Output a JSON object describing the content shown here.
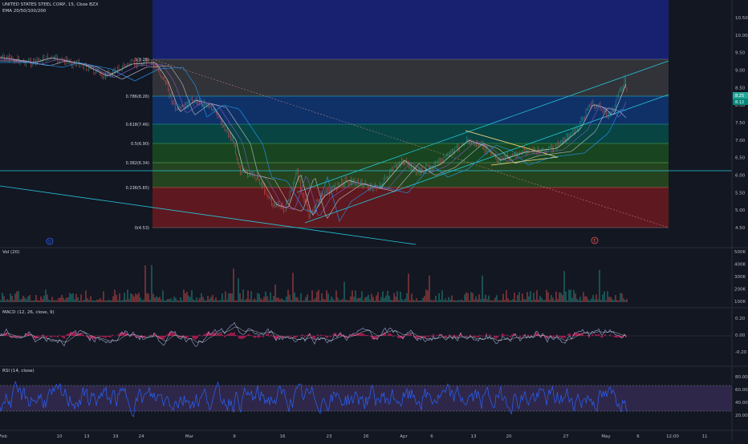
{
  "header": {
    "symbol_line": "UNITED STATES STEEL CORP, 15, Cboe BZX",
    "indicator_ema": "EMA 20/50/100/200"
  },
  "panes": {
    "volume_title": "Vol (20)",
    "macd_title": "MACD (12, 26, close, 9)",
    "rsi_title": "RSI (14, close)"
  },
  "price_axis": [
    "10.50",
    "10.00",
    "9.50",
    "9.00",
    "8.50",
    "8.00",
    "7.50",
    "7.00",
    "6.50",
    "6.00",
    "5.50",
    "5.00",
    "4.50"
  ],
  "price_tags": {
    "current": "8.25",
    "second": "8.12"
  },
  "fib_levels": [
    {
      "label": "0.786(8.26)"
    },
    {
      "label": "0.618(7.46)"
    },
    {
      "label": "0.5(6.90)"
    },
    {
      "label": "0.382(6.34)"
    },
    {
      "label": "0.236(5.65)"
    },
    {
      "label": "0(4.53)"
    },
    {
      "label": "1(9.28)"
    }
  ],
  "volume_axis": [
    "500K",
    "400K",
    "300K",
    "200K",
    "100K"
  ],
  "macd_axis": [
    "0.20",
    "0.00",
    "-0.20"
  ],
  "rsi_axis": [
    "80.00",
    "60.00",
    "40.00",
    "20.00"
  ],
  "time_axis": [
    "Feb",
    "10",
    "13",
    "19",
    "24",
    "Mar",
    "9",
    "16",
    "23",
    "26",
    "Apr",
    "6",
    "13",
    "20",
    "27",
    "May",
    "6",
    "12:00",
    "11"
  ],
  "markers": {
    "dividend": "D",
    "earnings": "E"
  },
  "colors": {
    "background": "#131722",
    "candle_up": "#26a69a",
    "candle_down": "#ef5350",
    "ema20": "#d1d4dc",
    "ema50": "#7e57c2",
    "ema100": "#b2b5be",
    "ema200": "#2196f3",
    "channel": "#26c6da",
    "macd_line": "#9fa8da",
    "macd_hist": "#e91e63",
    "rsi_line": "#2962ff",
    "rsi_band": "#7e57c2"
  }
}
